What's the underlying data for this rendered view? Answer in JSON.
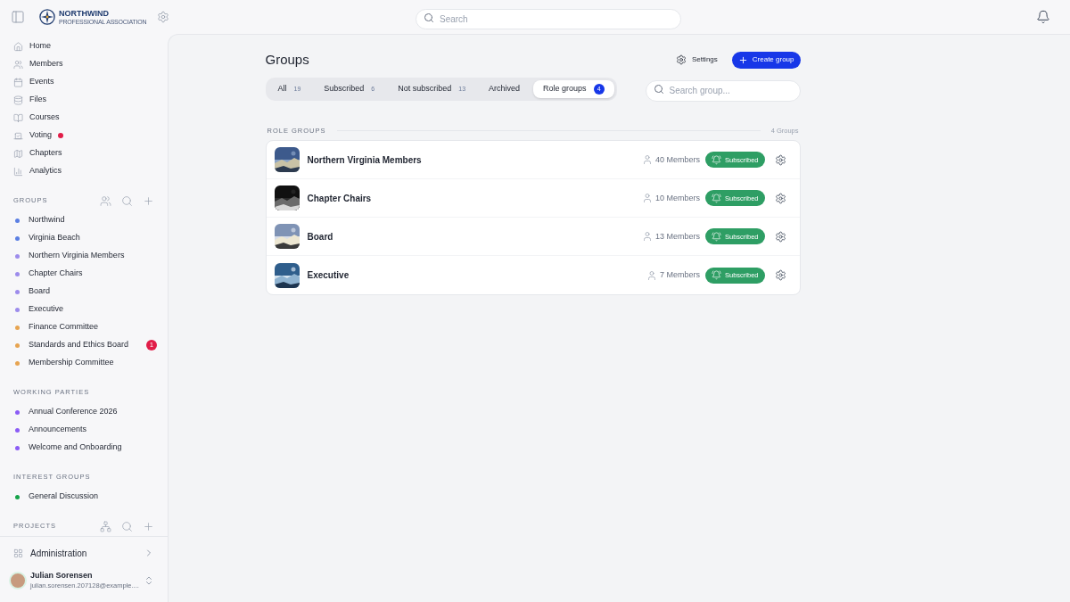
{
  "brand": {
    "name": "NORTHWIND",
    "tagline": "PROFESSIONAL ASSOCIATION"
  },
  "search": {
    "placeholder": "Search"
  },
  "nav": [
    {
      "label": "Home",
      "dot": false
    },
    {
      "label": "Members",
      "dot": false
    },
    {
      "label": "Events",
      "dot": false
    },
    {
      "label": "Files",
      "dot": false
    },
    {
      "label": "Courses",
      "dot": false
    },
    {
      "label": "Voting",
      "dot": true
    },
    {
      "label": "Chapters",
      "dot": false
    },
    {
      "label": "Analytics",
      "dot": false
    }
  ],
  "sections": [
    {
      "title": "GROUPS",
      "kind": "groups",
      "items": [
        {
          "label": "Northwind",
          "color": "#5b7fe3"
        },
        {
          "label": "Virginia Beach",
          "color": "#5b7fe3"
        },
        {
          "label": "Northern Virginia Members",
          "color": "#9d8cec"
        },
        {
          "label": "Chapter Chairs",
          "color": "#9d8cec"
        },
        {
          "label": "Board",
          "color": "#9d8cec"
        },
        {
          "label": "Executive",
          "color": "#9d8cec"
        },
        {
          "label": "Finance Committee",
          "color": "#e7a451"
        },
        {
          "label": "Standards and Ethics Board",
          "color": "#e7a451",
          "badge": "1"
        },
        {
          "label": "Membership Committee",
          "color": "#e7a451"
        }
      ]
    },
    {
      "title": "WORKING PARTIES",
      "kind": "plain",
      "items": [
        {
          "label": "Annual Conference 2026",
          "color": "#8b5cf6"
        },
        {
          "label": "Announcements",
          "color": "#8b5cf6"
        },
        {
          "label": "Welcome and Onboarding",
          "color": "#8b5cf6"
        }
      ]
    },
    {
      "title": "INTEREST GROUPS",
      "kind": "plain",
      "items": [
        {
          "label": "General Discussion",
          "color": "#16a34a"
        }
      ]
    },
    {
      "title": "PROJECTS",
      "kind": "projects"
    }
  ],
  "admin": {
    "label": "Administration"
  },
  "user": {
    "name": "Julian Sorensen",
    "email": "julian.sorensen.207128@example...."
  },
  "page": {
    "title": "Groups",
    "settings": "Settings",
    "create": "Create group"
  },
  "tabs": [
    {
      "label": "All",
      "count": "19",
      "selected": false
    },
    {
      "label": "Subscribed",
      "count": "6",
      "selected": false
    },
    {
      "label": "Not subscribed",
      "count": "13",
      "selected": false
    },
    {
      "label": "Archived",
      "selected": false
    },
    {
      "label": "Role groups",
      "count": "4",
      "selected": true
    }
  ],
  "group_search": {
    "placeholder": "Search group..."
  },
  "list": {
    "title": "ROLE GROUPS",
    "count": "4 Groups",
    "rows": [
      {
        "name": "Northern Virginia Members",
        "members": "40 Members",
        "status": "Subscribed",
        "kind": "picture"
      },
      {
        "name": "Chapter Chairs",
        "members": "10 Members",
        "status": "Subscribed",
        "kind": "picture"
      },
      {
        "name": "Board",
        "members": "13 Members",
        "status": "Subscribed",
        "kind": "picture"
      },
      {
        "name": "Executive",
        "members": "7 Members",
        "status": "Subscribed",
        "kind": "picture"
      }
    ]
  }
}
